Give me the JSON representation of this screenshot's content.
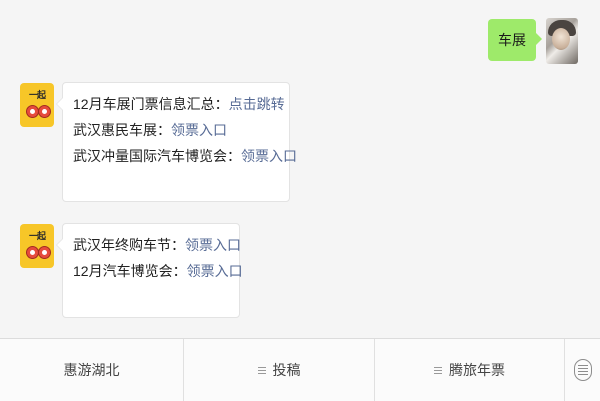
{
  "outgoing": {
    "text": "车展"
  },
  "incoming": [
    {
      "lines": [
        {
          "label": "12月车展门票信息汇总：",
          "link": "点击跳转"
        },
        {
          "label": "武汉惠民车展：",
          "link": "领票入口"
        },
        {
          "label": "武汉冲量国际汽车博览会：",
          "link": "领票入口"
        }
      ]
    },
    {
      "lines": [
        {
          "label": "武汉年终购车节：",
          "link": "领票入口"
        },
        {
          "label": "12月汽车博览会：",
          "link": "领票入口"
        }
      ]
    }
  ],
  "menu": {
    "items": [
      {
        "label": "惠游湖北"
      },
      {
        "label": "投稿"
      },
      {
        "label": "腾旅年票"
      }
    ]
  },
  "colors": {
    "outgoing_bubble": "#9eea6a",
    "link": "#576b95",
    "bot_avatar": "#f7c628"
  }
}
